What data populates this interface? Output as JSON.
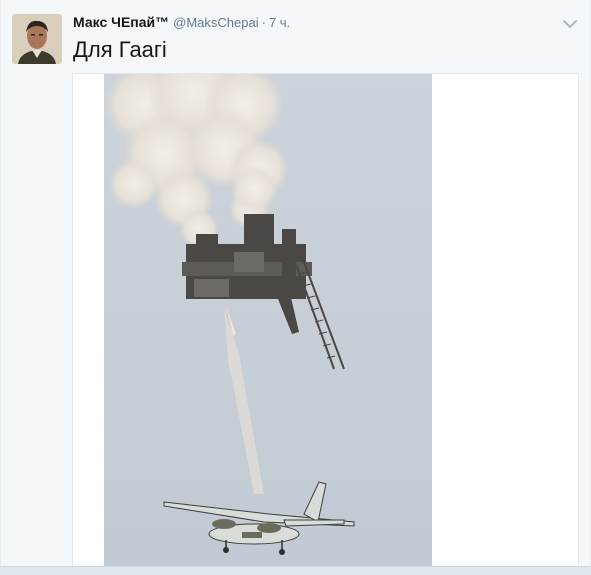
{
  "tweet": {
    "author_name": "Макс ЧЕпай™",
    "author_handle": "@MaksChepai",
    "separator": "·",
    "time": "7 ч.",
    "text": "Для Гаагі"
  },
  "icons": {
    "avatar": "avatar-photo",
    "menu": "chevron-down-icon"
  },
  "colors": {
    "text_primary": "#14171a",
    "text_secondary": "#657786",
    "background": "#f5f8fa",
    "sky": "#c9d1d9"
  }
}
